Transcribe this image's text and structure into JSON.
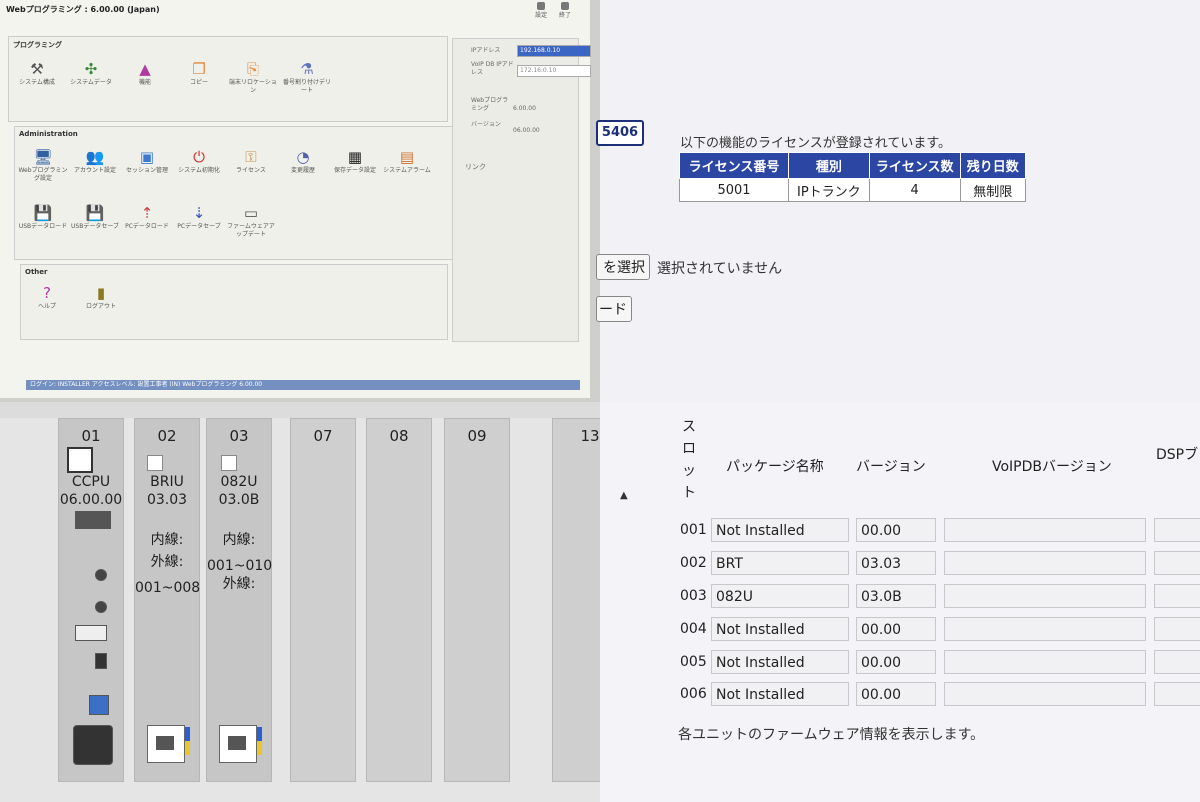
{
  "app_title": "Webプログラミング : 6.00.00 (Japan)",
  "top_icons": [
    "設定",
    "終了"
  ],
  "programming": {
    "title": "プログラミング",
    "items": [
      {
        "label": "システム構成",
        "icon": "tools-icon"
      },
      {
        "label": "システムデータ",
        "icon": "data-icon"
      },
      {
        "label": "機能",
        "icon": "function-icon"
      },
      {
        "label": "コピー",
        "icon": "copy-icon"
      },
      {
        "label": "端末リロケーション",
        "icon": "relocate-icon"
      },
      {
        "label": "番号割り付けデリート",
        "icon": "number-icon"
      }
    ]
  },
  "administration": {
    "title": "Administration",
    "items": [
      {
        "label": "Webプログラミング設定",
        "icon": "monitor-icon"
      },
      {
        "label": "アカウント設定",
        "icon": "users-icon"
      },
      {
        "label": "セッション管理",
        "icon": "session-icon"
      },
      {
        "label": "システム初期化",
        "icon": "power-icon"
      },
      {
        "label": "ライセンス",
        "icon": "key-icon"
      },
      {
        "label": "変更履歴",
        "icon": "history-icon"
      },
      {
        "label": "保存データ設定",
        "icon": "save-data-icon"
      },
      {
        "label": "システムアラーム",
        "icon": "alarm-icon"
      },
      {
        "label": "USBデータロード",
        "icon": "usb-load-icon"
      },
      {
        "label": "USBデータセーブ",
        "icon": "usb-save-icon"
      },
      {
        "label": "PCデータロード",
        "icon": "pc-load-icon"
      },
      {
        "label": "PCデータセーブ",
        "icon": "pc-save-icon"
      },
      {
        "label": "ファームウェアアップデート",
        "icon": "firmware-icon"
      }
    ]
  },
  "other": {
    "title": "Other",
    "items": [
      {
        "label": "ヘルプ",
        "icon": "help-icon"
      },
      {
        "label": "ログアウト",
        "icon": "logout-icon"
      }
    ]
  },
  "info_panel": {
    "ip_label": "IPアドレス",
    "ip_value": "192.168.0.10",
    "voip_label": "VoIP DB IPアドレス",
    "voip_value": "172.16.0.10",
    "web_label": "Webプログラミング",
    "web_value": "6.00.00",
    "version_label": "バージョン",
    "version_value": "06.00.00",
    "link_label": "リンク"
  },
  "status_bar": "ログイン: INSTALLER  アクセスレベル: 設置工事者 (IN)  Webプログラミング 6.00.00",
  "license": {
    "badge": "5406",
    "heading": "以下の機能のライセンスが登録されています。",
    "headers": [
      "ライセンス番号",
      "種別",
      "ライセンス数",
      "残り日数"
    ],
    "rows": [
      [
        "5001",
        "IPトランク",
        "4",
        "無制限"
      ]
    ],
    "select_button": "を選択",
    "no_selection": "選択されていません",
    "load_button": "ード"
  },
  "unit_slots": [
    {
      "num": "01",
      "lines": [
        "CCPU",
        "06.00.00"
      ]
    },
    {
      "num": "02",
      "lines": [
        "BRIU",
        "03.03",
        "",
        "内線:",
        "外線:",
        "001~008"
      ]
    },
    {
      "num": "03",
      "lines": [
        "082U",
        "03.0B",
        "",
        "内線:",
        "001~010",
        "外線:"
      ]
    },
    {
      "num": "07",
      "lines": []
    },
    {
      "num": "08",
      "lines": []
    },
    {
      "num": "09",
      "lines": []
    },
    {
      "num": "13",
      "lines": []
    }
  ],
  "firmware": {
    "headers": {
      "slot": "スロット",
      "package": "パッケージ名称",
      "version": "バージョン",
      "voipdb": "VoIPDBバージョン",
      "dsp": "DSPブ"
    },
    "rows": [
      {
        "slot": "001",
        "package": "Not Installed",
        "version": "00.00"
      },
      {
        "slot": "002",
        "package": "BRT",
        "version": "03.03"
      },
      {
        "slot": "003",
        "package": "082U",
        "version": "03.0B"
      },
      {
        "slot": "004",
        "package": "Not Installed",
        "version": "00.00"
      },
      {
        "slot": "005",
        "package": "Not Installed",
        "version": "00.00"
      },
      {
        "slot": "006",
        "package": "Not Installed",
        "version": "00.00"
      }
    ],
    "footer": "各ユニットのファームウェア情報を表示します。"
  }
}
